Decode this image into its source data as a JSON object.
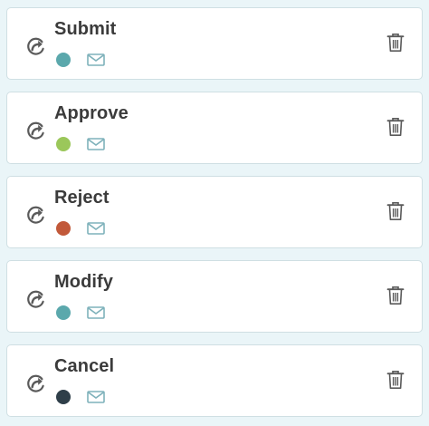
{
  "colors": {
    "background": "#eaf5f8",
    "card_border": "#cfdfe3",
    "icon_gray": "#5a5a5a",
    "mail_teal": "#7fb2bb"
  },
  "icons": {
    "action": "redo-arrow-circle-icon",
    "mail": "envelope-icon",
    "delete": "trash-icon"
  },
  "items": [
    {
      "label": "Submit",
      "color": "#5ba8ac"
    },
    {
      "label": "Approve",
      "color": "#9bc75a"
    },
    {
      "label": "Reject",
      "color": "#c2593a"
    },
    {
      "label": "Modify",
      "color": "#5ba8ac"
    },
    {
      "label": "Cancel",
      "color": "#2f3f49"
    }
  ]
}
